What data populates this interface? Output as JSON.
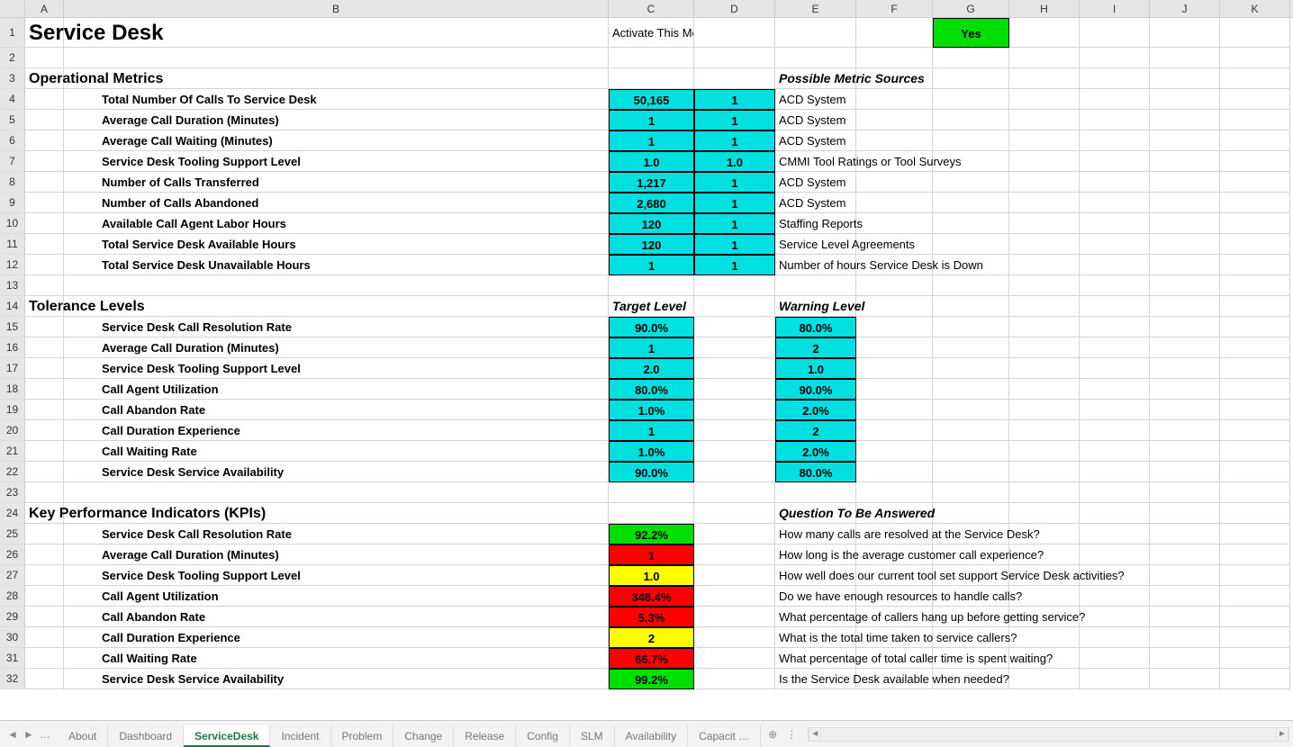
{
  "columns": [
    "A",
    "B",
    "C",
    "D",
    "E",
    "F",
    "G",
    "H",
    "I",
    "J",
    "K"
  ],
  "row_numbers": [
    "1",
    "2",
    "3",
    "4",
    "5",
    "6",
    "7",
    "8",
    "9",
    "10",
    "11",
    "12",
    "13",
    "14",
    "15",
    "16",
    "17",
    "18",
    "19",
    "20",
    "21",
    "22",
    "23",
    "24",
    "25",
    "26",
    "27",
    "28",
    "29",
    "30",
    "31",
    "32"
  ],
  "title": "Service Desk",
  "activate_label": "Activate This Model (Enter Yes or No)?",
  "activate_value": "Yes",
  "sec_operational": "Operational Metrics",
  "sec_possible_sources": "Possible Metric Sources",
  "ops": [
    {
      "label": "Total Number Of Calls To Service Desk",
      "c": "50,165",
      "d": "1",
      "src": "ACD System"
    },
    {
      "label": "Average Call Duration (Minutes)",
      "c": "1",
      "d": "1",
      "src": "ACD System"
    },
    {
      "label": "Average Call Waiting (Minutes)",
      "c": "1",
      "d": "1",
      "src": "ACD System"
    },
    {
      "label": "Service Desk Tooling Support Level",
      "c": "1.0",
      "d": "1.0",
      "src": "CMMI Tool Ratings or Tool Surveys"
    },
    {
      "label": "Number of Calls Transferred",
      "c": "1,217",
      "d": "1",
      "src": "ACD System"
    },
    {
      "label": "Number of Calls Abandoned",
      "c": "2,680",
      "d": "1",
      "src": "ACD System"
    },
    {
      "label": "Available Call Agent Labor Hours",
      "c": "120",
      "d": "1",
      "src": "Staffing Reports"
    },
    {
      "label": "Total Service Desk Available Hours",
      "c": "120",
      "d": "1",
      "src": "Service Level Agreements"
    },
    {
      "label": "Total Service Desk Unavailable Hours",
      "c": "1",
      "d": "1",
      "src": "Number of hours Service Desk is Down"
    }
  ],
  "sec_tolerance": "Tolerance Levels",
  "sec_target": "Target Level",
  "sec_warning": "Warning Level",
  "tol": [
    {
      "label": "Service Desk Call Resolution Rate",
      "t": "90.0%",
      "w": "80.0%"
    },
    {
      "label": "Average Call Duration (Minutes)",
      "t": "1",
      "w": "2"
    },
    {
      "label": "Service Desk Tooling Support Level",
      "t": "2.0",
      "w": "1.0"
    },
    {
      "label": "Call Agent Utilization",
      "t": "80.0%",
      "w": "90.0%"
    },
    {
      "label": "Call Abandon Rate",
      "t": "1.0%",
      "w": "2.0%"
    },
    {
      "label": "Call Duration Experience",
      "t": "1",
      "w": "2"
    },
    {
      "label": "Call Waiting Rate",
      "t": "1.0%",
      "w": "2.0%"
    },
    {
      "label": "Service Desk Service Availability",
      "t": "90.0%",
      "w": "80.0%"
    }
  ],
  "sec_kpi": "Key Performance Indicators (KPIs)",
  "sec_question": "Question To Be Answered",
  "kpi": [
    {
      "label": "Service Desk Call Resolution Rate",
      "v": "92.2%",
      "color": "green",
      "q": "How many calls are resolved at the Service Desk?"
    },
    {
      "label": "Average Call Duration (Minutes)",
      "v": "1",
      "color": "red",
      "q": "How long is the average customer call experience?"
    },
    {
      "label": "Service Desk Tooling Support Level",
      "v": "1.0",
      "color": "yellow",
      "q": "How well does our current tool set support Service Desk activities?"
    },
    {
      "label": "Call Agent Utilization",
      "v": "348.4%",
      "color": "red",
      "q": "Do we have enough resources to handle calls?"
    },
    {
      "label": "Call Abandon Rate",
      "v": "5.3%",
      "color": "red",
      "q": "What percentage of callers hang up before getting service?"
    },
    {
      "label": "Call Duration Experience",
      "v": "2",
      "color": "yellow",
      "q": "What is the total time taken to service callers?"
    },
    {
      "label": "Call Waiting Rate",
      "v": "66.7%",
      "color": "red",
      "q": "What percentage of total caller time is spent waiting?"
    },
    {
      "label": "Service Desk Service Availability",
      "v": "99.2%",
      "color": "green",
      "q": "Is the Service Desk available when needed?"
    }
  ],
  "tabs": [
    "About",
    "Dashboard",
    "ServiceDesk",
    "Incident",
    "Problem",
    "Change",
    "Release",
    "Config",
    "SLM",
    "Availability",
    "Capacit …"
  ],
  "active_tab": "ServiceDesk",
  "nav_prev": "◄",
  "nav_next": "►",
  "nav_dots": "…",
  "nav_plus": "⊕",
  "nav_menu": "⋮"
}
